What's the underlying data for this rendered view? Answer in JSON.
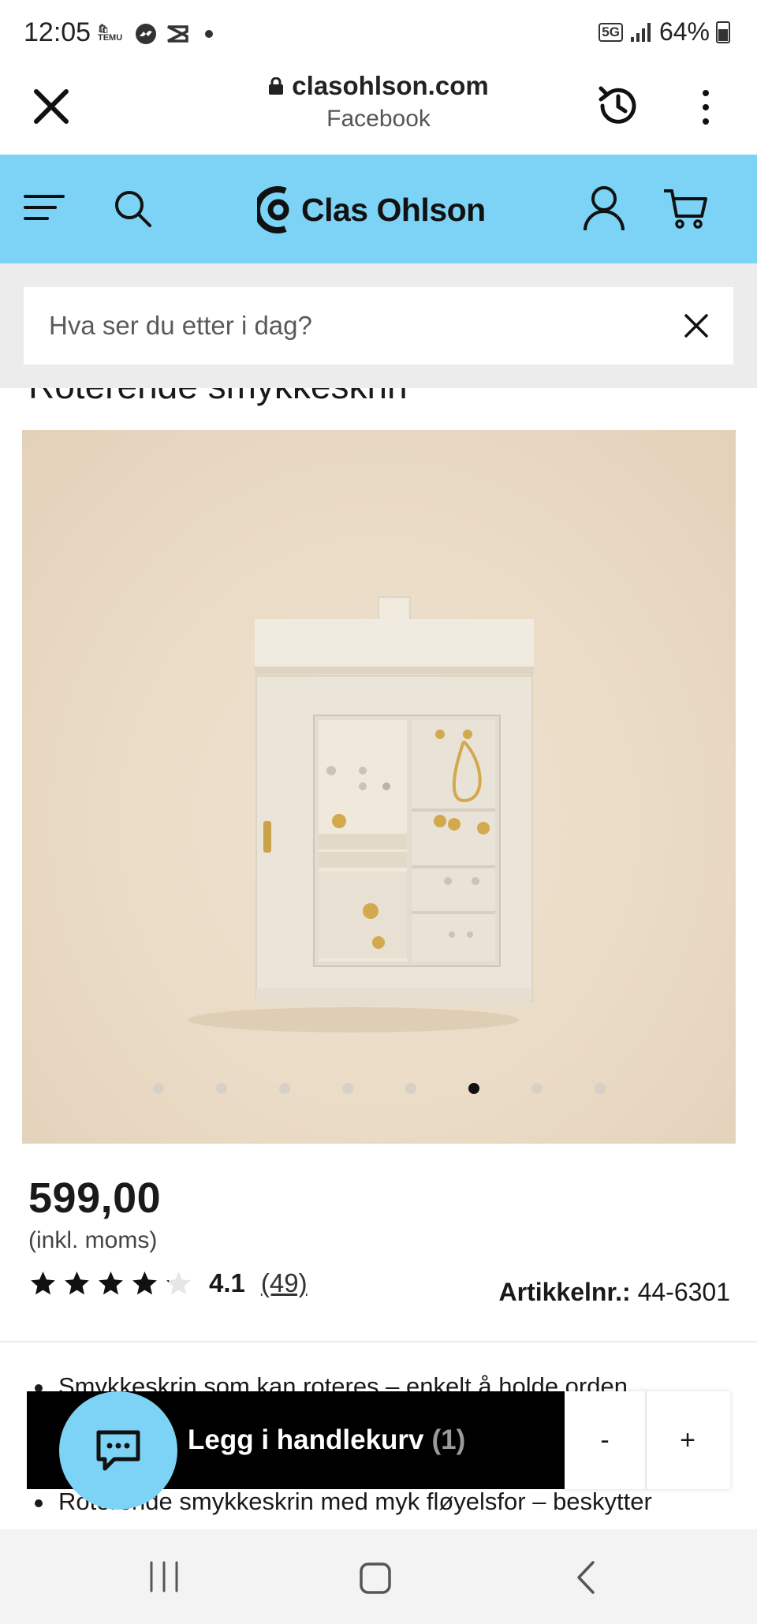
{
  "status_bar": {
    "time": "12:05",
    "temu_label": "🛍\nTEMU",
    "network": "5G",
    "battery": "64%"
  },
  "browser": {
    "domain": "clasohlson.com",
    "subtitle": "Facebook"
  },
  "site_header": {
    "brand": "Clas Ohlson",
    "background_color": "#7dd3f5"
  },
  "search": {
    "placeholder": "Hva ser du etter i dag?",
    "value": ""
  },
  "product": {
    "title": "Roterende smykkeskrin",
    "image_alt": "Roterende smykkeskrin",
    "carousel": {
      "total": 8,
      "active_index": 5
    },
    "price": "599,00",
    "price_note": "(inkl. moms)",
    "rating": {
      "value": "4.1",
      "stars": 4.1,
      "max": 5,
      "count": "(49)"
    },
    "article_label": "Artikkelnr.:",
    "article_number": "44-6301",
    "bullets": [
      "Smykkeskrin som kan roteres – enkelt å holde orden",
      "Roterende smykkeskrin med myk fløyelsfor – beskytter"
    ]
  },
  "cart_bar": {
    "add_label": "Legg i handlekurv",
    "quantity_display": "(1)",
    "minus_label": "-",
    "plus_label": "+"
  },
  "icons": {
    "close": "close-icon",
    "lock": "lock-icon",
    "history": "history-icon",
    "more": "more-vertical-icon",
    "menu": "menu-icon",
    "search": "search-icon",
    "account": "account-icon",
    "cart": "cart-icon",
    "clear": "clear-icon",
    "chat": "chat-icon"
  }
}
